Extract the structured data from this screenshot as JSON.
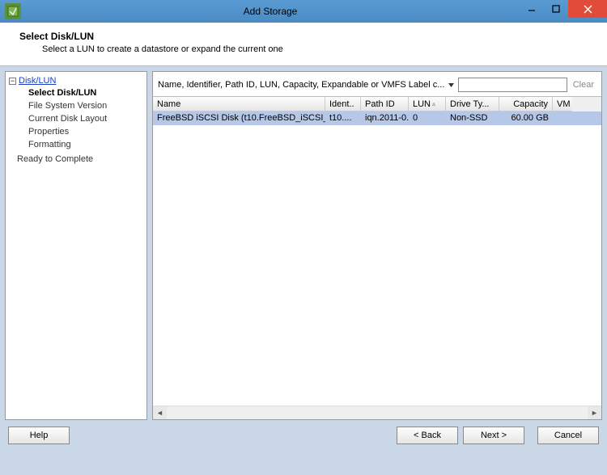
{
  "window": {
    "title": "Add Storage"
  },
  "header": {
    "title": "Select Disk/LUN",
    "subtitle": "Select a LUN to create a datastore or expand the current one"
  },
  "nav": {
    "top": "Disk/LUN",
    "items": [
      "Select Disk/LUN",
      "File System Version",
      "Current Disk Layout",
      "Properties",
      "Formatting"
    ],
    "ready": "Ready to Complete"
  },
  "filter": {
    "label": "Name, Identifier, Path ID, LUN, Capacity, Expandable or VMFS Label c...",
    "value": "",
    "clear": "Clear"
  },
  "table": {
    "columns": {
      "name": "Name",
      "ident": "Ident..",
      "path": "Path ID",
      "lun": "LUN",
      "drive": "Drive Ty...",
      "capacity": "Capacity",
      "vm": "VM"
    },
    "rows": [
      {
        "name": "FreeBSD iSCSI Disk (t10.FreeBSD_iSCSI_...",
        "ident": "t10....",
        "path": "iqn.2011-0...",
        "lun": "0",
        "drive": "Non-SSD",
        "capacity": "60.00 GB",
        "vm": ""
      }
    ]
  },
  "footer": {
    "help": "Help",
    "back": "< Back",
    "next": "Next >",
    "cancel": "Cancel"
  }
}
